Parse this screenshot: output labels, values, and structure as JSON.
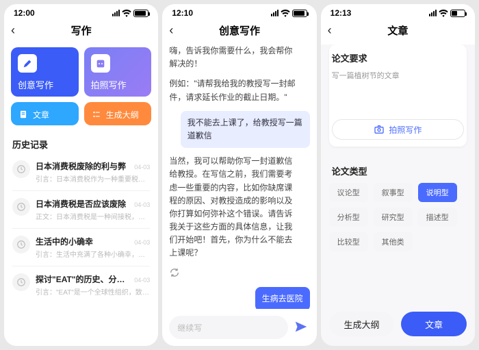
{
  "screen1": {
    "time": "12:00",
    "battery_pct": 80,
    "title": "写作",
    "cards": {
      "creative": "创意写作",
      "photo": "拍照写作",
      "article": "文章",
      "outline": "生成大纲"
    },
    "history_label": "历史记录",
    "history": [
      {
        "title": "日本消费税废除的利与弊",
        "time": "04-03",
        "sub": "引言：日本消费税作为一种重要税收方式，"
      },
      {
        "title": "日本消费税是否应该废除",
        "time": "04-03",
        "sub": "正文：日本消费税是一种间接税，对商品和"
      },
      {
        "title": "生活中的小确幸",
        "time": "04-03",
        "sub": "引言：生活中充满了各种小确幸，让我们感"
      },
      {
        "title": "探讨\"EAT\"的历史、分布和使命",
        "time": "04-03",
        "sub": "引言：\"EAT\"是一个全球性组织，致力于推"
      }
    ]
  },
  "screen2": {
    "time": "12:10",
    "battery_pct": 80,
    "title": "创意写作",
    "ai_intro": "嗨，告诉我你需要什么，我会帮你解决的！",
    "ai_example": "例如：\"请帮我给我的教授写一封邮件，请求延长作业的截止日期。\"",
    "user_prompt": "我不能去上课了，给教授写一篇道歉信",
    "ai_reply": "当然，我可以帮助你写一封道歉信给教授。在写信之前，我们需要考虑一些重要的内容，比如你缺席课程的原因、对教授造成的影响以及你打算如何弥补这个错误。请告诉我关于这些方面的具体信息，让我们开始吧！首先，你为什么不能去上课呢？",
    "user_reply": "生病去医院",
    "placeholder": "继续写"
  },
  "screen3": {
    "time": "12:13",
    "battery_pct": 40,
    "title": "文章",
    "req_label": "论文要求",
    "req_value": "写一篇植树节的文章",
    "photo_btn": "拍照写作",
    "type_label": "论文类型",
    "types": [
      "议论型",
      "叙事型",
      "说明型",
      "分析型",
      "研究型",
      "描述型",
      "比较型",
      "其他类"
    ],
    "active_type_index": 2,
    "btn_outline": "生成大纲",
    "btn_article": "文章"
  }
}
